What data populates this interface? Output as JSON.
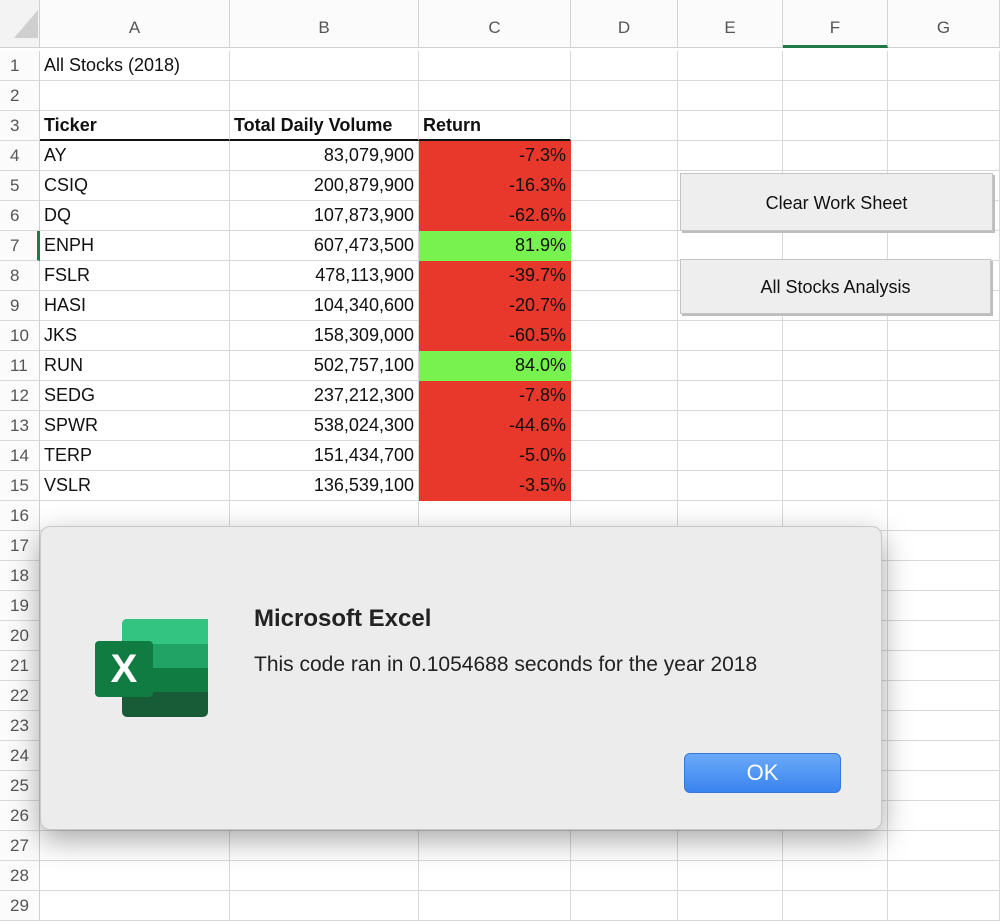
{
  "columns": [
    "A",
    "B",
    "C",
    "D",
    "E",
    "F",
    "G"
  ],
  "rows": [
    "1",
    "2",
    "3",
    "4",
    "5",
    "6",
    "7",
    "8",
    "9",
    "10",
    "11",
    "12",
    "13",
    "14",
    "15",
    "16",
    "17",
    "18",
    "19",
    "20",
    "21",
    "22",
    "23",
    "24",
    "25",
    "26",
    "27",
    "28",
    "29"
  ],
  "title": "All Stocks (2018)",
  "headers": {
    "ticker": "Ticker",
    "volume": "Total Daily Volume",
    "return": "Return"
  },
  "stocks": [
    {
      "ticker": "AY",
      "volume": "83,079,900",
      "return": "-7.3%",
      "status": "negative"
    },
    {
      "ticker": "CSIQ",
      "volume": "200,879,900",
      "return": "-16.3%",
      "status": "negative"
    },
    {
      "ticker": "DQ",
      "volume": "107,873,900",
      "return": "-62.6%",
      "status": "negative"
    },
    {
      "ticker": "ENPH",
      "volume": "607,473,500",
      "return": "81.9%",
      "status": "positive"
    },
    {
      "ticker": "FSLR",
      "volume": "478,113,900",
      "return": "-39.7%",
      "status": "negative"
    },
    {
      "ticker": "HASI",
      "volume": "104,340,600",
      "return": "-20.7%",
      "status": "negative"
    },
    {
      "ticker": "JKS",
      "volume": "158,309,000",
      "return": "-60.5%",
      "status": "negative"
    },
    {
      "ticker": "RUN",
      "volume": "502,757,100",
      "return": "84.0%",
      "status": "positive"
    },
    {
      "ticker": "SEDG",
      "volume": "237,212,300",
      "return": "-7.8%",
      "status": "negative"
    },
    {
      "ticker": "SPWR",
      "volume": "538,024,300",
      "return": "-44.6%",
      "status": "negative"
    },
    {
      "ticker": "TERP",
      "volume": "151,434,700",
      "return": "-5.0%",
      "status": "negative"
    },
    {
      "ticker": "VSLR",
      "volume": "136,539,100",
      "return": "-3.5%",
      "status": "negative"
    }
  ],
  "colors": {
    "negative": "#e8372b",
    "positive": "#77f24e",
    "excel_green": "#217346",
    "ok_blue": "#3a84f0"
  },
  "buttons": {
    "clear": "Clear Work Sheet",
    "analysis": "All Stocks Analysis"
  },
  "dialog": {
    "title": "Microsoft Excel",
    "message": "This code ran in 0.1054688 seconds for the year 2018",
    "ok": "OK",
    "icon": "excel-icon",
    "icon_letter": "X"
  }
}
